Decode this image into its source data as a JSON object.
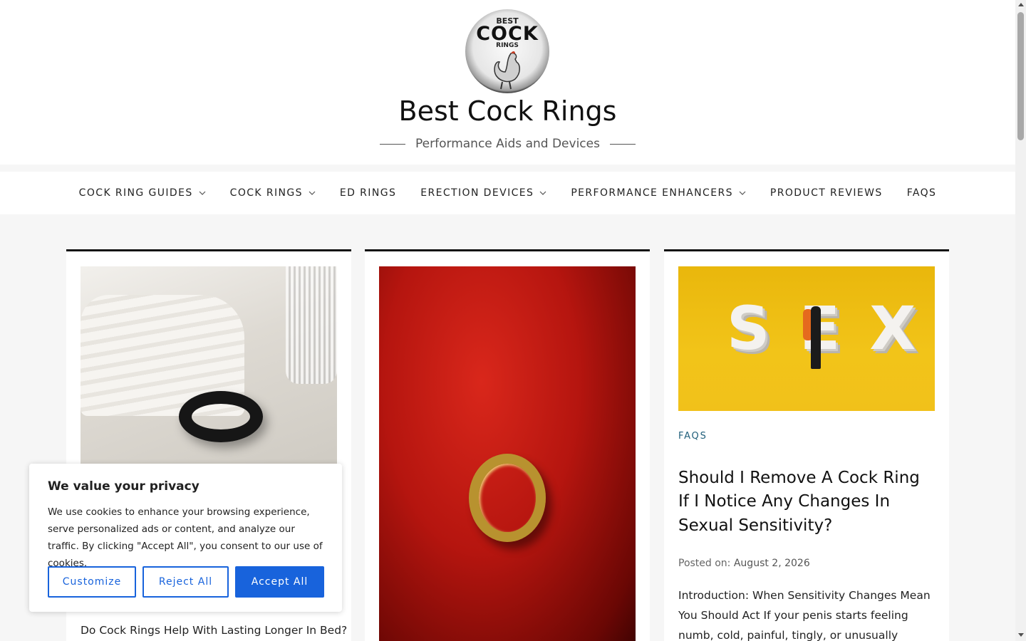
{
  "header": {
    "logo": {
      "line1": "BEST",
      "line2": "COCK",
      "line3": "RINGS"
    },
    "site_title": "Best Cock Rings",
    "tagline": "Performance Aids and Devices"
  },
  "nav": {
    "items": [
      {
        "label": "COCK RING GUIDES",
        "has_dropdown": true
      },
      {
        "label": "COCK RINGS",
        "has_dropdown": true
      },
      {
        "label": "ED RINGS",
        "has_dropdown": false
      },
      {
        "label": "ERECTION DEVICES",
        "has_dropdown": true
      },
      {
        "label": "PERFORMANCE ENHANCERS",
        "has_dropdown": true
      },
      {
        "label": "PRODUCT REVIEWS",
        "has_dropdown": false
      },
      {
        "label": "FAQS",
        "has_dropdown": false
      }
    ]
  },
  "posts": [
    {
      "title": "Do Cock Rings Help With Lasting Longer In Bed?"
    },
    {
      "title": ""
    },
    {
      "category": "FAQS",
      "title": "Should I Remove A Cock Ring If I Notice Any Changes In Sexual Sensitivity?",
      "meta_label": "Posted on:",
      "date": "August 2, 2026",
      "excerpt": "Introduction: When Sensitivity Changes Mean You Should Act If your penis starts feeling numb, cold, painful, tingly, or unusually swollen while"
    }
  ],
  "cookie_banner": {
    "heading": "We value your privacy",
    "body": "We use cookies to enhance your browsing experience, serve personalized ads or content, and analyze our traffic. By clicking \"Accept All\", you consent to our use of cookies.",
    "buttons": {
      "customize": "Customize",
      "reject": "Reject All",
      "accept": "Accept All"
    }
  },
  "colors": {
    "accent": "#1863dc",
    "category": "#1f5e7a",
    "card_border": "#111111"
  }
}
